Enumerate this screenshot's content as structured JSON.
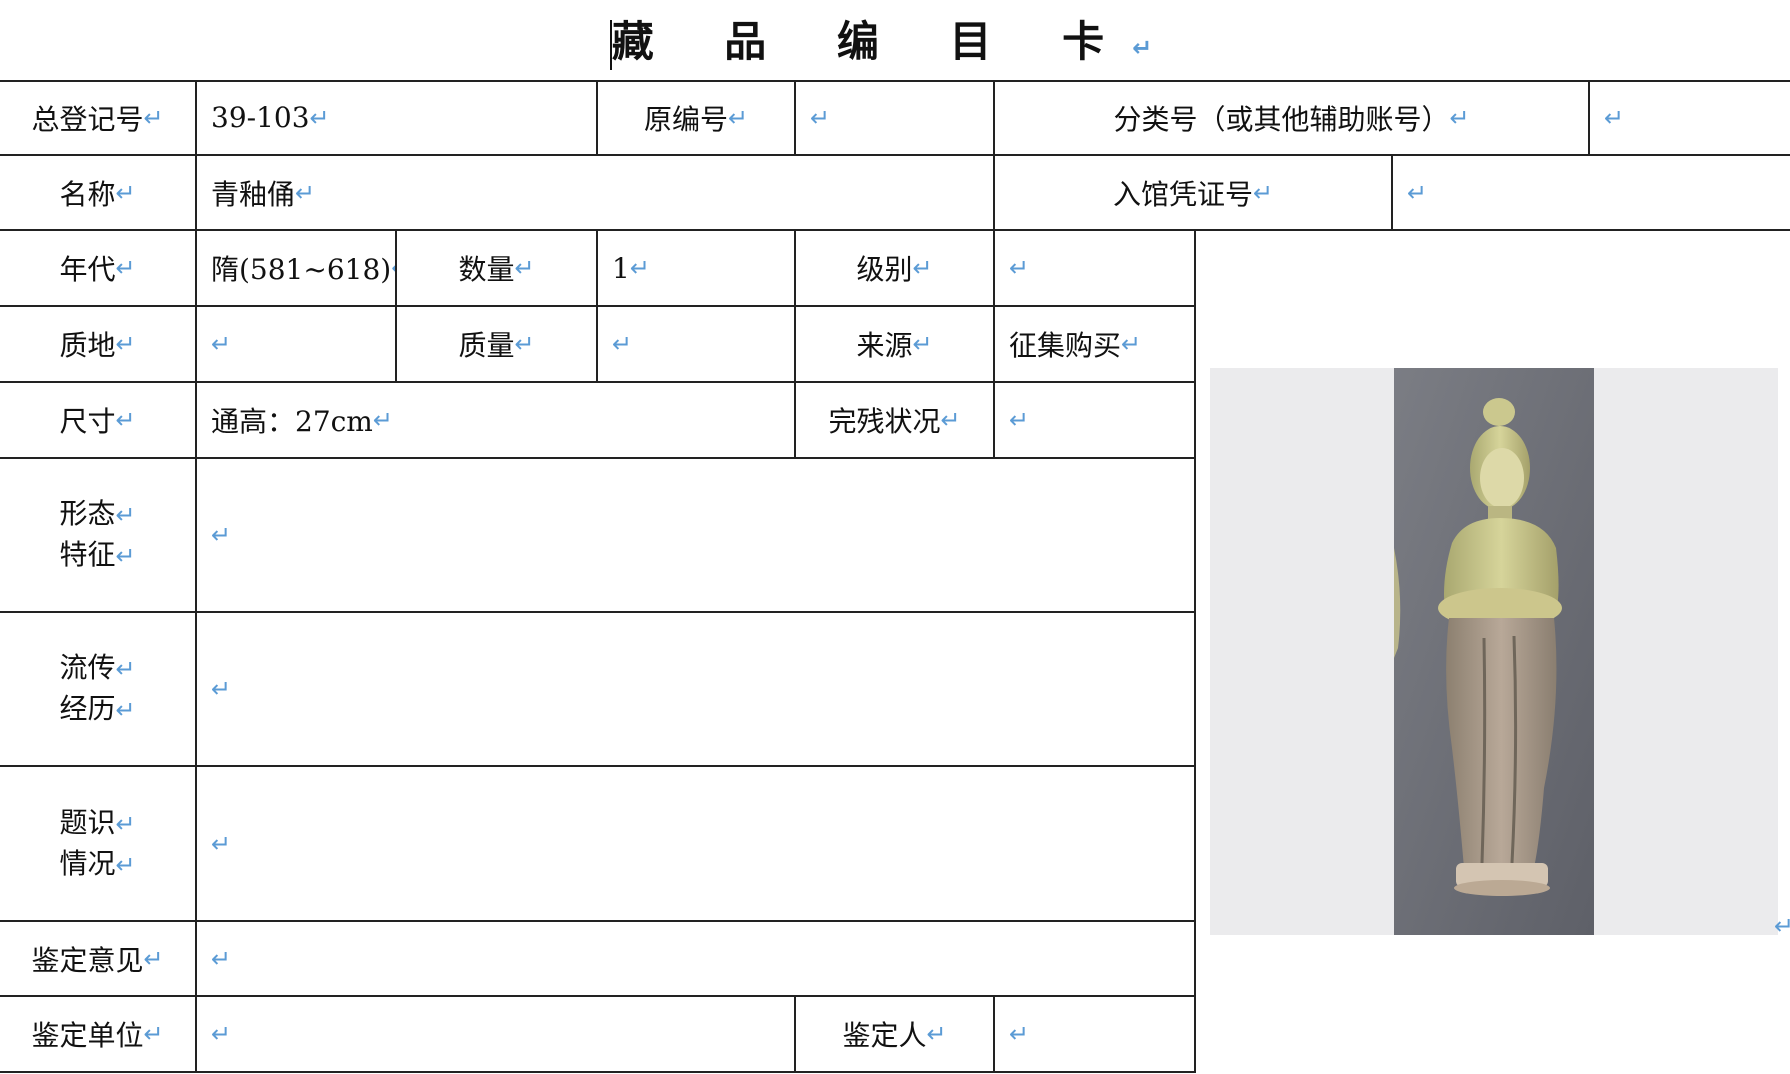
{
  "title": "藏 品 编 目 卡",
  "return_mark": "↵",
  "fields": {
    "reg_no_label": "总登记号",
    "reg_no_value": "39-103",
    "orig_no_label": "原编号",
    "orig_no_value": "",
    "class_no_label": "分类号（或其他辅助账号）",
    "class_no_value": "",
    "name_label": "名称",
    "name_value": "青釉俑",
    "voucher_label": "入馆凭证号",
    "voucher_value": "",
    "era_label": "年代",
    "era_value": "隋(581~618)",
    "qty_label": "数量",
    "qty_value": "1",
    "grade_label": "级别",
    "grade_value": "",
    "material_label": "质地",
    "material_value": "",
    "weight_label": "质量",
    "weight_value": "",
    "source_label": "来源",
    "source_value": "征集购买",
    "size_label": "尺寸",
    "size_value": "通高：27cm",
    "condition_label": "完残状况",
    "condition_value": "",
    "form_label_1": "形态",
    "form_label_2": "特征",
    "form_value": "",
    "history_label_1": "流传",
    "history_label_2": "经历",
    "history_value": "",
    "inscription_label_1": "题识",
    "inscription_label_2": "情况",
    "inscription_value": "",
    "opinion_label": "鉴定意见",
    "opinion_value": "",
    "unit_label": "鉴定单位",
    "unit_value": "",
    "appraiser_label": "鉴定人",
    "appraiser_value": ""
  },
  "colors": {
    "return_mark": "#5b9bd5",
    "border": "#222222",
    "figure_glaze": "#c9c48a"
  }
}
